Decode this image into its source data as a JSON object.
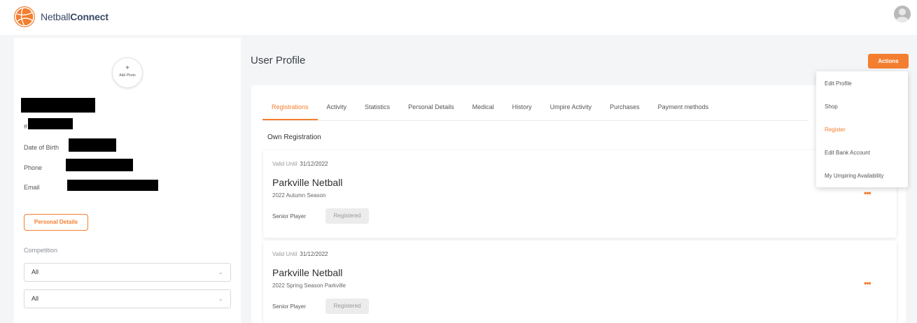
{
  "app": {
    "brand_prefix": "Netball",
    "brand_suffix": "Connect",
    "accent_color": "#f47e2f"
  },
  "profile": {
    "add_photo_plus": "+",
    "add_photo_label": "Add Photo",
    "hash_prefix": "#",
    "dob_label": "Date of Birth",
    "phone_label": "Phone",
    "email_label": "Email",
    "personal_details_button": "Personal Details",
    "competition_label": "Competition",
    "select_1_value": "All",
    "select_2_value": "All"
  },
  "header": {
    "title": "User Profile",
    "actions_button": "Actions"
  },
  "tabs": [
    {
      "label": "Registrations",
      "active": true
    },
    {
      "label": "Activity"
    },
    {
      "label": "Statistics"
    },
    {
      "label": "Personal Details"
    },
    {
      "label": "Medical"
    },
    {
      "label": "History"
    },
    {
      "label": "Umpire Activity"
    },
    {
      "label": "Purchases"
    },
    {
      "label": "Payment methods"
    }
  ],
  "registrations": {
    "section_title": "Own Registration",
    "items": [
      {
        "valid_label": "Valid Until",
        "valid_date": "31/12/2022",
        "organisation": "Parkville Netball",
        "season": "2022 Autumn Season",
        "role": "Senior Player",
        "status": "Registered",
        "more": "•••"
      },
      {
        "valid_label": "Valid Until",
        "valid_date": "31/12/2022",
        "organisation": "Parkville Netball",
        "season": "2022 Spring Season Parkville",
        "role": "Senior Player",
        "status": "Registered",
        "more": "•••"
      }
    ]
  },
  "actions_menu": {
    "items": [
      {
        "label": "Edit Profile"
      },
      {
        "label": "Shop"
      },
      {
        "label": "Register",
        "highlighted": true
      },
      {
        "label": "Edit Bank Account"
      },
      {
        "label": "My Umpiring Availability"
      }
    ]
  }
}
